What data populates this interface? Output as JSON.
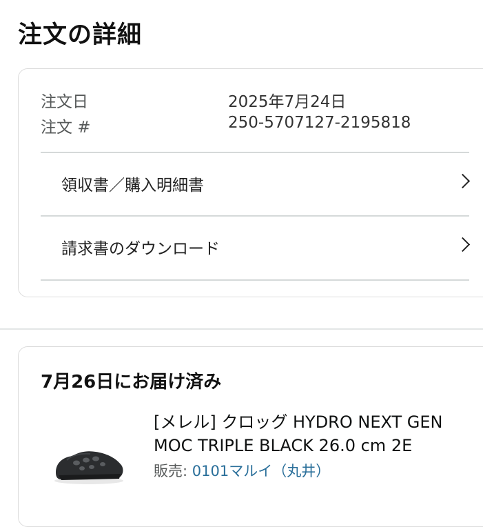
{
  "page": {
    "title": "注文の詳細"
  },
  "order_info": {
    "date_label": "注文日",
    "date_value": "2025年7月24日",
    "number_label": "注文 #",
    "number_value": "250-5707127-2195818"
  },
  "links": [
    {
      "label": "領収書／購入明細書",
      "icon": "chevron-right-icon"
    },
    {
      "label": "請求書のダウンロード",
      "icon": "chevron-right-icon"
    }
  ],
  "delivery": {
    "status": "7月26日にお届け済み",
    "product": {
      "title_line1": "[メレル] クロッグ HYDRO NEXT GEN",
      "title_line2": "MOC TRIPLE BLACK 26.0 cm 2E",
      "seller_label": "販売: ",
      "seller_name": "0101マルイ（丸井）",
      "image": "black-clog-shoe"
    }
  },
  "colors": {
    "link_blue": "#2a6f9a",
    "divider": "#d5d9d9",
    "card_border": "#dcdcdc"
  }
}
